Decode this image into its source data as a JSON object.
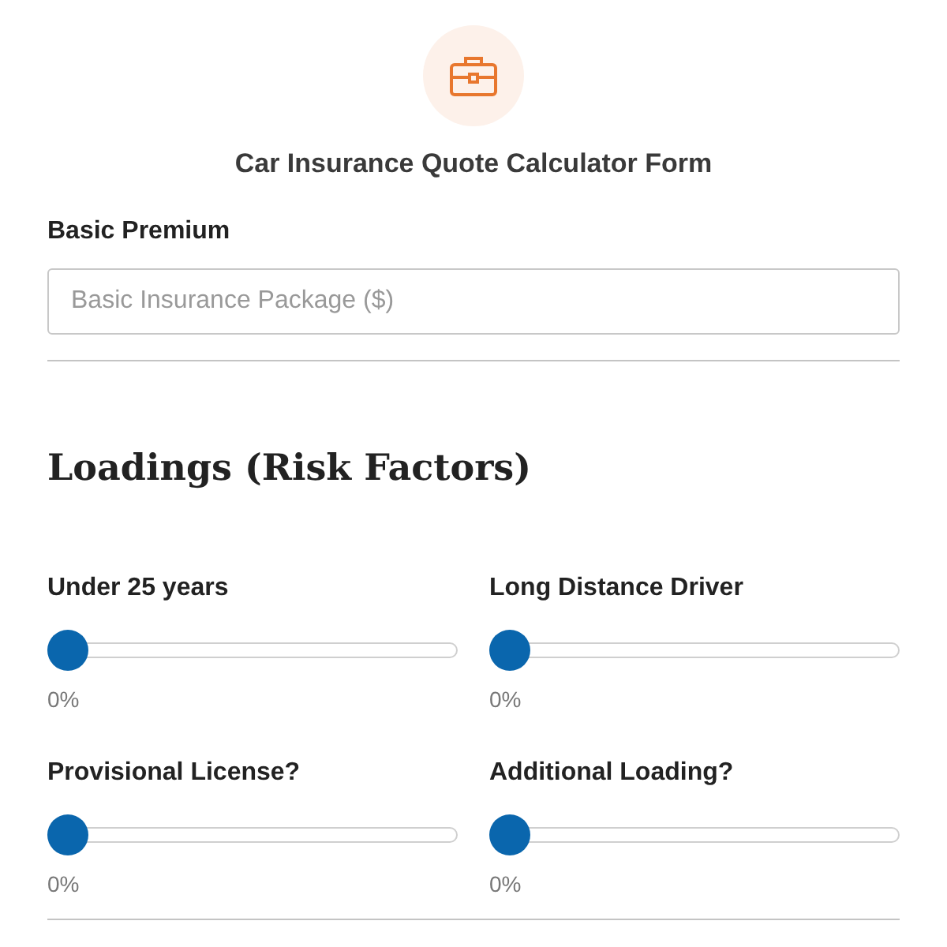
{
  "form": {
    "title": "Car Insurance Quote Calculator Form"
  },
  "basic_premium": {
    "label": "Basic Premium",
    "placeholder": "Basic Insurance Package ($)"
  },
  "section": {
    "heading": "Loadings (Risk Factors)"
  },
  "sliders": [
    {
      "label": "Under 25 years",
      "level": 0,
      "reading": "0%"
    },
    {
      "label": "Long Distance Driver",
      "level": 0,
      "reading": "0%"
    },
    {
      "label": "Provisional License?",
      "level": 0,
      "reading": "0%"
    },
    {
      "label": "Additional Loading?",
      "level": 0,
      "reading": "0%"
    }
  ]
}
